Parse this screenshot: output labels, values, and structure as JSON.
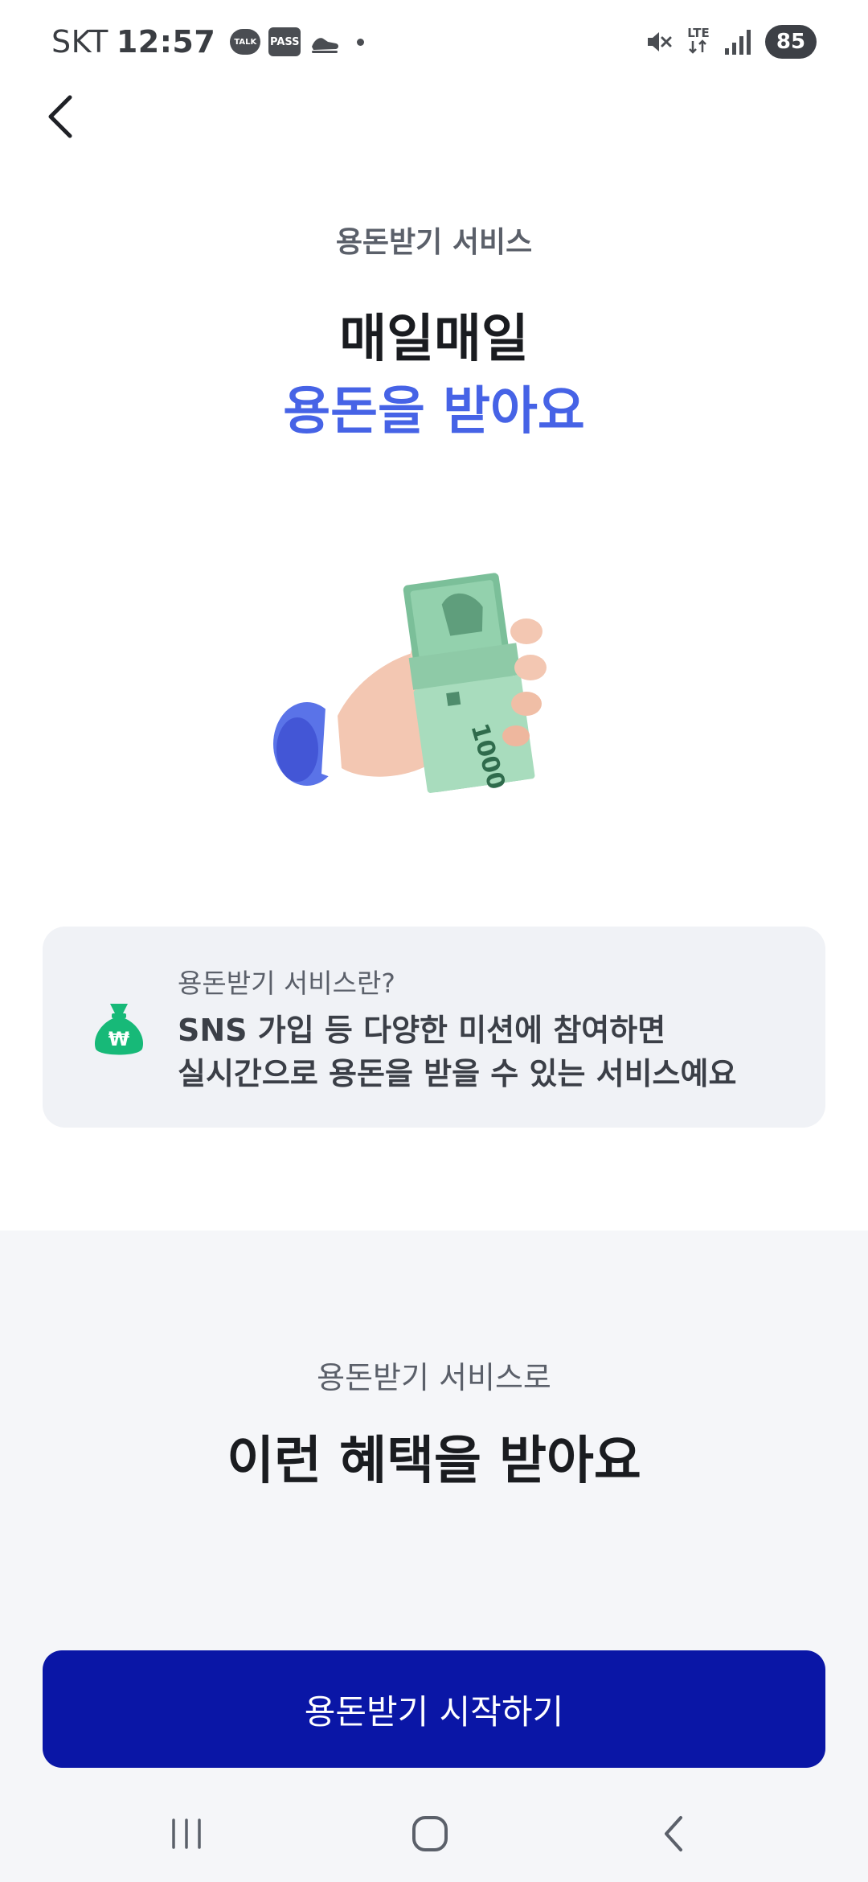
{
  "status_bar": {
    "carrier": "SKT",
    "time": "12:57",
    "talk_badge": "TALK",
    "pass_badge": "PASS",
    "lte": "LTE",
    "battery": "85"
  },
  "hero": {
    "label": "용돈받기 서비스",
    "title": "매일매일",
    "title_accent": "용돈을 받아요",
    "accent_color": "#4663e6"
  },
  "info_card": {
    "question": "용돈받기 서비스란?",
    "description_line1": "SNS 가입 등 다양한 미션에 참여하면",
    "description_line2": "실시간으로 용돈을 받을 수 있는 서비스예요",
    "icon": "money-bag-icon"
  },
  "benefits": {
    "subtitle": "용돈받기 서비스로",
    "title": "이런 혜택을 받아요"
  },
  "cta": {
    "label": "용돈받기 시작하기",
    "color": "#0a16a6"
  },
  "banknote_text": "1000"
}
